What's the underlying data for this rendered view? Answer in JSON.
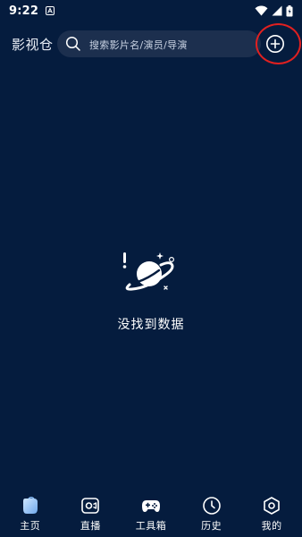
{
  "status_bar": {
    "time": "9:22",
    "notification_icon": "a-box-icon",
    "icons": [
      "wifi-icon",
      "signal-icon",
      "battery-icon"
    ]
  },
  "header": {
    "app_title": "影视仓",
    "search": {
      "placeholder": "搜索影片名/演员/导演",
      "icon": "search-icon"
    },
    "add_button_icon": "plus-circle-icon",
    "highlight_color": "#e02020"
  },
  "main": {
    "empty_state": {
      "icon": "planet-icon",
      "message": "没找到数据"
    }
  },
  "bottom_nav": {
    "items": [
      {
        "label": "主页",
        "icon": "home-icon",
        "selected": true
      },
      {
        "label": "直播",
        "icon": "live-camera-icon",
        "selected": false
      },
      {
        "label": "工具箱",
        "icon": "gamepad-icon",
        "selected": false
      },
      {
        "label": "历史",
        "icon": "clock-icon",
        "selected": false
      },
      {
        "label": "我的",
        "icon": "settings-hexagon-icon",
        "selected": false
      }
    ]
  },
  "colors": {
    "background": "#051c3e",
    "search_background": "#1c2f4e",
    "accent_blue": "#8fc3ff",
    "text": "#ffffff"
  }
}
